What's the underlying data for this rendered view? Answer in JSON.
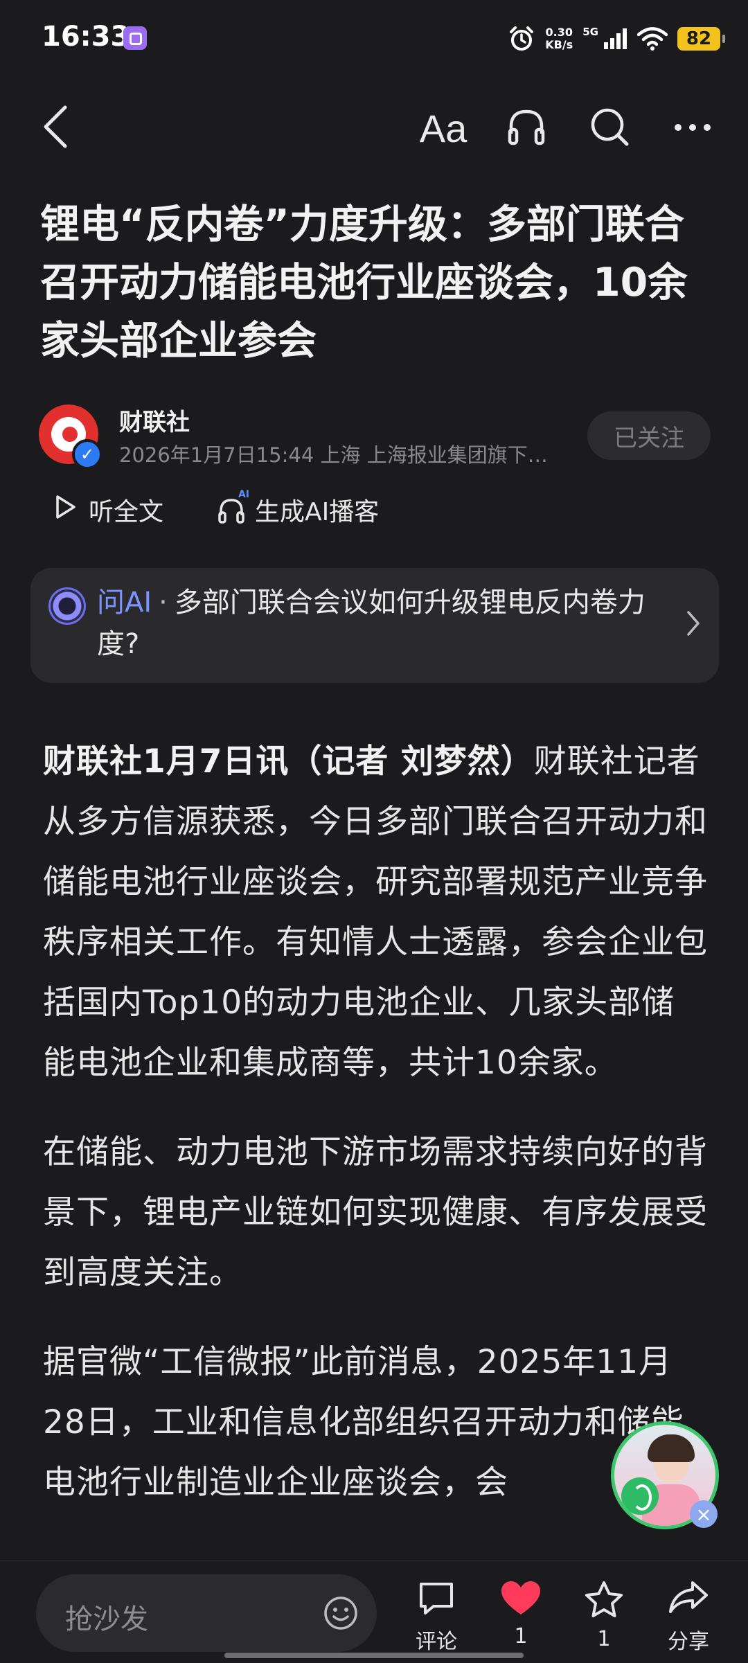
{
  "status_bar": {
    "time": "16:33",
    "net_speed_value": "0.30",
    "net_speed_unit": "KB/s",
    "network": "5G",
    "battery": "82",
    "icons": [
      "app-notification-icon",
      "alarm-icon",
      "signal-icon",
      "wifi-icon",
      "battery-icon"
    ]
  },
  "nav": {
    "font_label": "Aa",
    "icons": [
      "back-arrow-icon",
      "font-size-icon",
      "headphones-icon",
      "search-icon",
      "more-icon"
    ]
  },
  "article": {
    "title": "锂电“反内卷”力度升级：多部门联合召开动力储能电池行业座谈会，10余家头部企业参会",
    "author": {
      "name": "财联社",
      "meta": "2026年1月7日15:44 上海 上海报业集团旗下…",
      "follow_label": "已关注"
    },
    "actions": {
      "listen_label": "听全文",
      "podcast_label": "生成AI播客",
      "podcast_badge": "AI"
    },
    "ask_ai": {
      "label": "问AI",
      "separator": "·",
      "question": "多部门联合会议如何升级锂电反内卷力度?"
    },
    "paragraphs": [
      {
        "lead": "财联社1月7日讯（记者 刘梦然）",
        "text": "财联社记者从多方信源获悉，今日多部门联合召开动力和储能电池行业座谈会，研究部署规范产业竞争秩序相关工作。有知情人士透露，参会企业包括国内Top10的动力电池企业、几家头部储能电池企业和集成商等，共计10余家。"
      },
      {
        "lead": "",
        "text": "在储能、动力电池下游市场需求持续向好的背景下，锂电产业链如何实现健康、有序发展受到高度关注。"
      },
      {
        "lead": "",
        "text": "据官微“工信微报”此前消息，2025年11月28日，工业和信息化部组织召开动力和储能电池行业制造业企业座谈会，会"
      }
    ]
  },
  "bottom_bar": {
    "comment_placeholder": "抢沙发",
    "comment_label": "评论",
    "like_count": "1",
    "star_count": "1",
    "share_label": "分享",
    "like_color": "#ff3b5c"
  }
}
